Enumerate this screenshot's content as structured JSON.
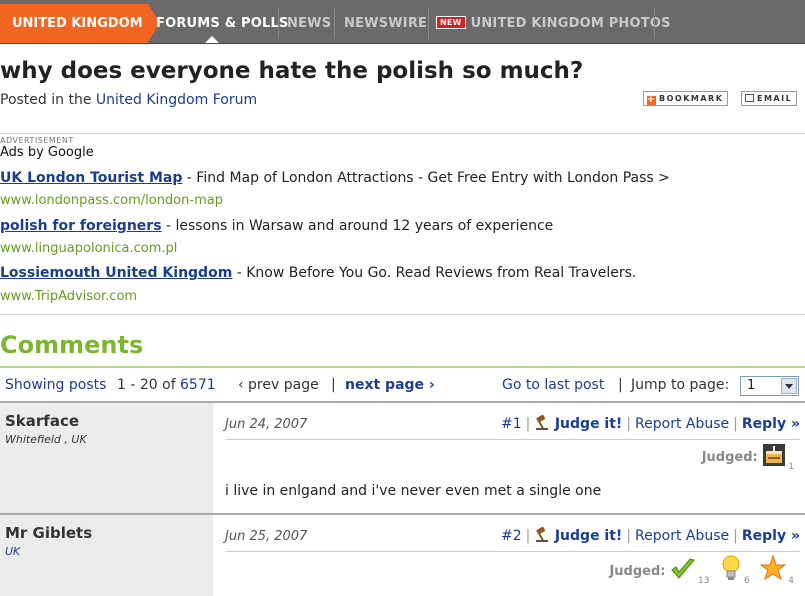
{
  "nav": {
    "home": "UNITED KINGDOM",
    "items": [
      "FORUMS & POLLS",
      "NEWS",
      "NEWSWIRE",
      "UNITED KINGDOM PHOTOS"
    ],
    "new_badge": "NEW",
    "accent": "#f26522"
  },
  "page": {
    "title": "why does everyone hate the polish so much?",
    "posted_prefix": "Posted in the",
    "forum_link": "United Kingdom Forum",
    "bookmark": "BOOKMARK",
    "email": "EMAIL"
  },
  "ads": {
    "label": "ADVERTISEMENT",
    "ads_by": "Ads by Google",
    "items": [
      {
        "title": "UK London Tourist Map",
        "desc": " - Find Map of London Attractions - Get Free Entry with London Pass >",
        "url": "www.londonpass.com/london-map"
      },
      {
        "title": "polish for foreigners",
        "desc": " - lessons in Warsaw and around 12 years of experience",
        "url": "www.linguapolonica.com.pl"
      },
      {
        "title": "Lossiemouth United Kingdom",
        "desc": " - Know Before You Go. Read Reviews from Real Travelers.",
        "url": "www.TripAdvisor.com"
      }
    ]
  },
  "comments": {
    "heading": "Comments",
    "showing_label": "Showing posts",
    "range": "1 - 20 of",
    "total": "6571",
    "prev": "‹ prev page",
    "pipe": "|",
    "next": "next page ›",
    "last": "Go to last post",
    "jump_label": "Jump to page:",
    "jump_value": "1"
  },
  "posts": [
    {
      "author": "Skarface",
      "location": "Whitefield , UK",
      "date": "Jun 24, 2007",
      "num": "#1",
      "judge": "Judge it!",
      "report": "Report Abuse",
      "reply": "Reply »",
      "judged_label": "Judged:",
      "judgements": [
        {
          "icon": "cake-icon",
          "count": "1"
        }
      ],
      "text": "i live in enlgand and i've never even met a single one"
    },
    {
      "author": "Mr Giblets",
      "location": "UK",
      "date": "Jun 25, 2007",
      "num": "#2",
      "judge": "Judge it!",
      "report": "Report Abuse",
      "reply": "Reply »",
      "judged_label": "Judged:",
      "judgements": [
        {
          "icon": "checkmark-icon",
          "count": "13"
        },
        {
          "icon": "lightbulb-icon",
          "count": "6"
        },
        {
          "icon": "star-icon",
          "count": "4"
        }
      ]
    }
  ]
}
